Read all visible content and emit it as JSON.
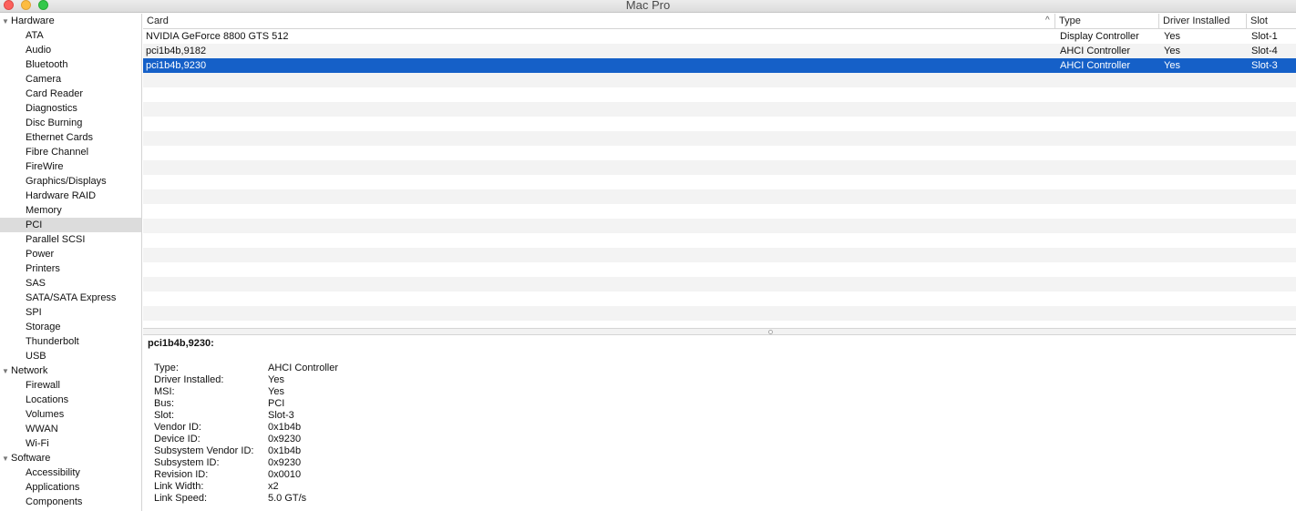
{
  "window": {
    "title": "Mac Pro"
  },
  "sidebar": {
    "groups": [
      {
        "label": "Hardware",
        "items": [
          "ATA",
          "Audio",
          "Bluetooth",
          "Camera",
          "Card Reader",
          "Diagnostics",
          "Disc Burning",
          "Ethernet Cards",
          "Fibre Channel",
          "FireWire",
          "Graphics/Displays",
          "Hardware RAID",
          "Memory",
          "PCI",
          "Parallel SCSI",
          "Power",
          "Printers",
          "SAS",
          "SATA/SATA Express",
          "SPI",
          "Storage",
          "Thunderbolt",
          "USB"
        ]
      },
      {
        "label": "Network",
        "items": [
          "Firewall",
          "Locations",
          "Volumes",
          "WWAN",
          "Wi-Fi"
        ]
      },
      {
        "label": "Software",
        "items": [
          "Accessibility",
          "Applications",
          "Components"
        ]
      }
    ],
    "selected": "PCI"
  },
  "table": {
    "columns": {
      "card": "Card",
      "type": "Type",
      "driver": "Driver Installed",
      "slot": "Slot"
    },
    "sort_indicator": "^",
    "rows": [
      {
        "card": "NVIDIA GeForce 8800 GTS 512",
        "type": "Display Controller",
        "driver": "Yes",
        "slot": "Slot-1"
      },
      {
        "card": "pci1b4b,9182",
        "type": "AHCI Controller",
        "driver": "Yes",
        "slot": "Slot-4"
      },
      {
        "card": "pci1b4b,9230",
        "type": "AHCI Controller",
        "driver": "Yes",
        "slot": "Slot-3"
      }
    ],
    "selected_index": 2
  },
  "detail": {
    "title": "pci1b4b,9230:",
    "properties": [
      {
        "key": "Type:",
        "value": "AHCI Controller"
      },
      {
        "key": "Driver Installed:",
        "value": "Yes"
      },
      {
        "key": "MSI:",
        "value": "Yes"
      },
      {
        "key": "Bus:",
        "value": "PCI"
      },
      {
        "key": "Slot:",
        "value": "Slot-3"
      },
      {
        "key": "Vendor ID:",
        "value": "0x1b4b"
      },
      {
        "key": "Device ID:",
        "value": "0x9230"
      },
      {
        "key": "Subsystem Vendor ID:",
        "value": "0x1b4b"
      },
      {
        "key": "Subsystem ID:",
        "value": "0x9230"
      },
      {
        "key": "Revision ID:",
        "value": "0x0010"
      },
      {
        "key": "Link Width:",
        "value": "x2"
      },
      {
        "key": "Link Speed:",
        "value": "5.0 GT/s"
      }
    ]
  }
}
